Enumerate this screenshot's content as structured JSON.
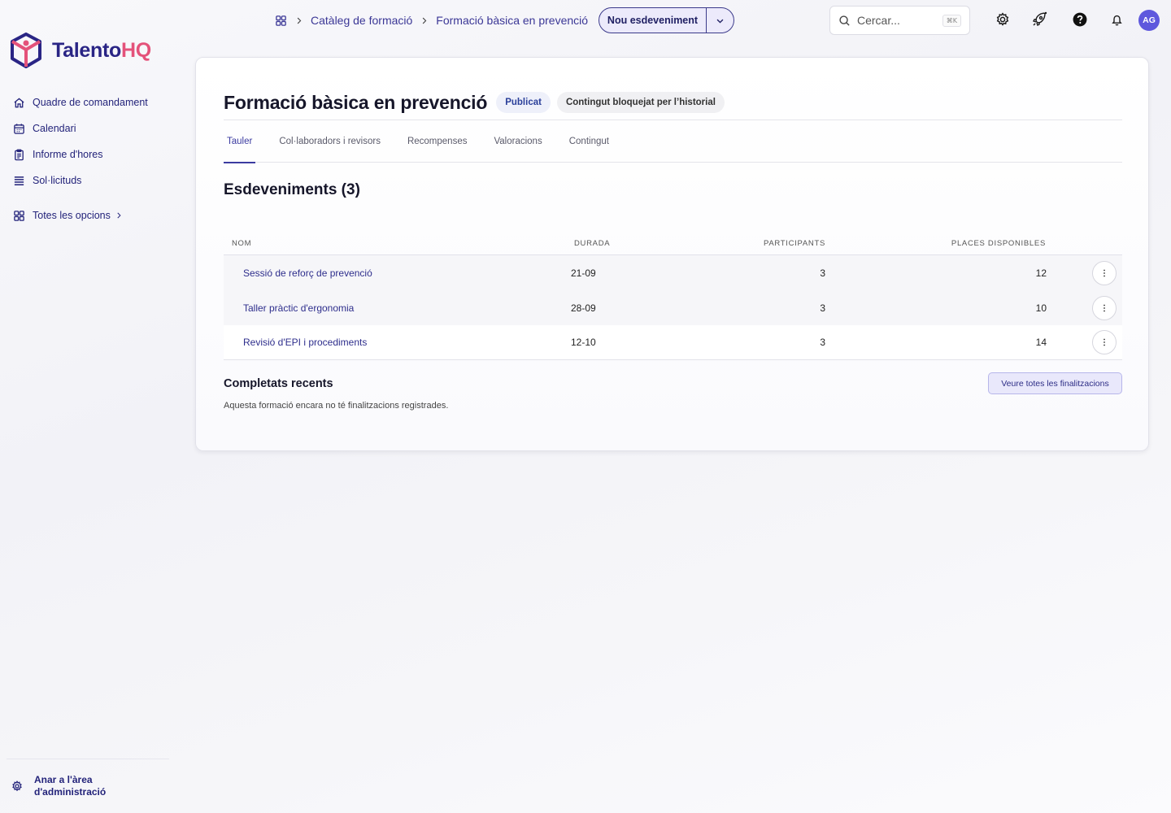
{
  "app": {
    "logo_part1": "Talento",
    "logo_part2": "HQ"
  },
  "colors": {
    "brand_primary": "#2a2585",
    "brand_accent": "#e4527a",
    "avatar_bg": "#5e58dd"
  },
  "sidebar": {
    "items": [
      {
        "label": "Quadre de comandament",
        "icon": "home-icon"
      },
      {
        "label": "Calendari",
        "icon": "calendar-icon"
      },
      {
        "label": "Informe d'hores",
        "icon": "clipboard-icon"
      },
      {
        "label": "Sol·licituds",
        "icon": "list-icon"
      }
    ],
    "all_options": "Totes les opcions",
    "admin_link": "Anar a l'àrea d'administració"
  },
  "topbar": {
    "breadcrumb": [
      "Catàleg de formació",
      "Formació bàsica en prevenció"
    ],
    "new_event_button": "Nou esdeveniment",
    "search_placeholder": "Cercar...",
    "search_shortcut": "⌘K",
    "avatar_initials": "AG"
  },
  "page": {
    "title": "Formació bàsica en prevenció",
    "status_badge": "Publicat",
    "lock_badge": "Contingut bloquejat per l’historial",
    "tabs": [
      "Tauler",
      "Col·laboradors i revisors",
      "Recompenses",
      "Valoracions",
      "Contingut"
    ],
    "active_tab": "Tauler"
  },
  "events": {
    "section_title": "Esdeveniments (3)",
    "columns": [
      "NOM",
      "DURADA",
      "PARTICIPANTS",
      "PLACES DISPONIBLES"
    ],
    "rows": [
      {
        "name": "Sessió de reforç de prevenció",
        "duration": "21-09",
        "participants": "3",
        "available": "12"
      },
      {
        "name": "Taller pràctic d'ergonomia",
        "duration": "28-09",
        "participants": "3",
        "available": "10"
      },
      {
        "name": "Revisió d'EPI i procediments",
        "duration": "12-10",
        "participants": "3",
        "available": "14"
      }
    ]
  },
  "recent": {
    "title": "Completats recents",
    "empty_text": "Aquesta formació encara no té finalitzacions registrades.",
    "view_all_button": "Veure totes les finalitzacions"
  }
}
